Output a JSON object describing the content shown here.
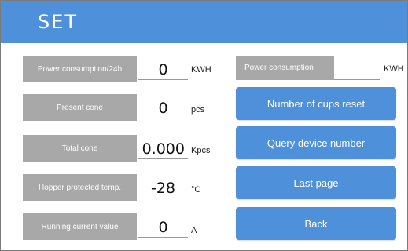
{
  "header": {
    "title": "SET"
  },
  "rows": [
    {
      "label": "Power consumption/24h",
      "value": "0",
      "unit": "KWH"
    },
    {
      "label": "Present cone",
      "value": "0",
      "unit": "pcs"
    },
    {
      "label": "Total cone",
      "value": "0.000",
      "unit": "Kpcs"
    },
    {
      "label": "Hopper protected temp.",
      "value": "-28",
      "unit": "°C"
    },
    {
      "label": "Running current value",
      "value": "0",
      "unit": "A"
    }
  ],
  "power_consumption": {
    "label": "Power consumption",
    "value": "",
    "unit": "KWH"
  },
  "buttons": {
    "reset_cups": "Number of cups reset",
    "query_device": "Query device number",
    "last_page": "Last page",
    "back": "Back"
  },
  "colors": {
    "header": "#4f90db",
    "button": "#4f90db",
    "label_box": "#a8a8a8"
  }
}
